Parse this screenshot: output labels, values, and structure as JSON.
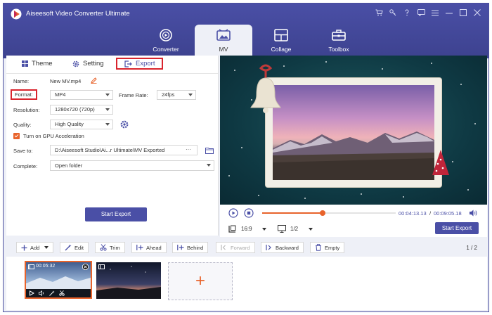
{
  "app": {
    "title": "Aiseesoft Video Converter Ultimate",
    "icons": [
      "cart-icon",
      "key-icon",
      "help-icon",
      "feedback-icon",
      "menu-icon",
      "minimize-icon",
      "maximize-icon",
      "close-icon"
    ]
  },
  "nav": {
    "tabs": [
      {
        "label": "Converter",
        "active": false
      },
      {
        "label": "MV",
        "active": true
      },
      {
        "label": "Collage",
        "active": false
      },
      {
        "label": "Toolbox",
        "active": false
      }
    ]
  },
  "subtabs": {
    "theme": "Theme",
    "setting": "Setting",
    "export": "Export"
  },
  "export": {
    "name_label": "Name:",
    "name_value": "New MV.mp4",
    "format_label": "Format:",
    "format_value": "MP4",
    "framerate_label": "Frame Rate:",
    "framerate_value": "24fps",
    "resolution_label": "Resolution:",
    "resolution_value": "1280x720 (720p)",
    "quality_label": "Quality:",
    "quality_value": "High Quality",
    "gpu_label": "Turn on GPU Acceleration",
    "gpu_checked": true,
    "saveto_label": "Save to:",
    "saveto_value": "D:\\Aiseesoft Studio\\Ai...r Ultimate\\MV Exported",
    "saveto_more": "···",
    "complete_label": "Complete:",
    "complete_value": "Open folder",
    "start_export": "Start Export"
  },
  "player": {
    "current_time": "00:04:13.13",
    "total_time": "00:09:05.18",
    "time_sep": "/",
    "progress": 0.45,
    "aspect": "16:9",
    "page": "1/2",
    "start_export": "Start Export"
  },
  "toolbar": {
    "add": "Add",
    "edit": "Edit",
    "trim": "Trim",
    "ahead": "Ahead",
    "behind": "Behind",
    "forward": "Forward",
    "backward": "Backward",
    "empty": "Empty",
    "page_indicator": "1 / 2"
  },
  "timeline": {
    "clip1_duration": "00:05:32",
    "add_symbol": "+"
  },
  "colors": {
    "brand": "#4a4fa6",
    "accent": "#e8632b",
    "highlight": "#d9242d"
  }
}
